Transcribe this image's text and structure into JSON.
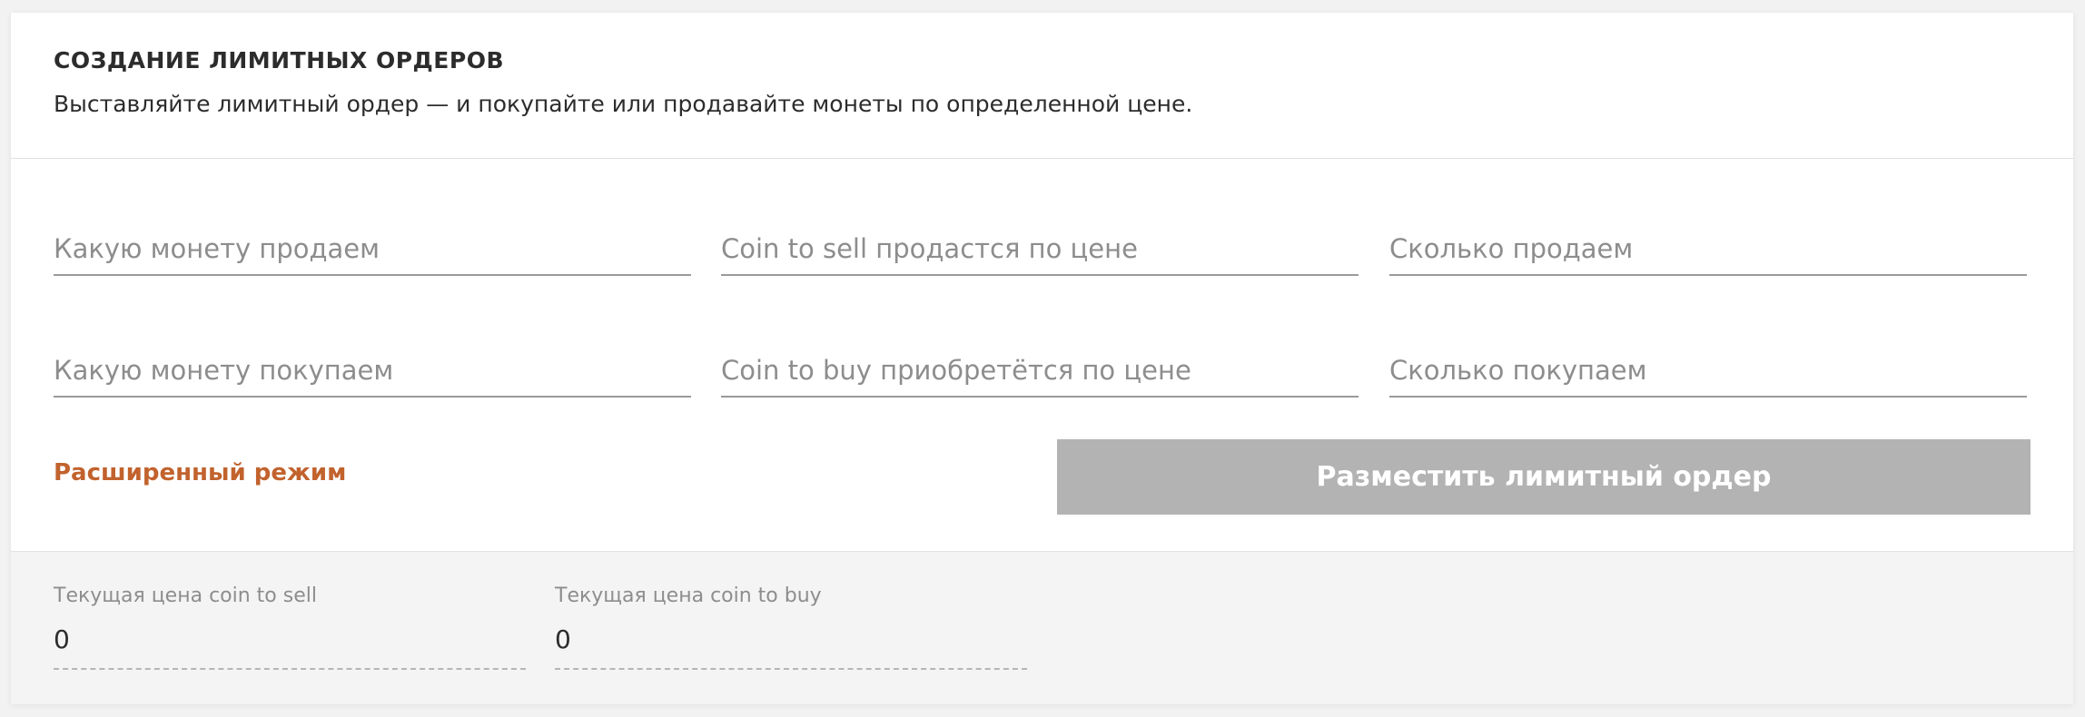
{
  "header": {
    "title": "СОЗДАНИЕ ЛИМИТНЫХ ОРДЕРОВ",
    "subtitle": "Выставляйте лимитный ордер — и покупайте или продавайте монеты по определенной цене."
  },
  "form": {
    "sell_coin": {
      "placeholder": "Какую монету продаем",
      "value": ""
    },
    "sell_price": {
      "placeholder": "Coin to sell продастся по цене",
      "value": ""
    },
    "sell_amount": {
      "placeholder": "Сколько продаем",
      "value": ""
    },
    "buy_coin": {
      "placeholder": "Какую монету покупаем",
      "value": ""
    },
    "buy_price": {
      "placeholder": "Coin to buy приобретётся по цене",
      "value": ""
    },
    "buy_amount": {
      "placeholder": "Сколько покупаем",
      "value": ""
    },
    "advanced_mode_label": "Расширенный режим",
    "submit_label": "Разместить лимитный ордер"
  },
  "prices": {
    "sell": {
      "label": "Текущая цена coin to sell",
      "value": "0"
    },
    "buy": {
      "label": "Текущая цена coin to buy",
      "value": "0"
    }
  },
  "colors": {
    "accent": "#c2622d",
    "button_disabled": "#b3b3b3",
    "footer_bg": "#f4f4f4"
  }
}
